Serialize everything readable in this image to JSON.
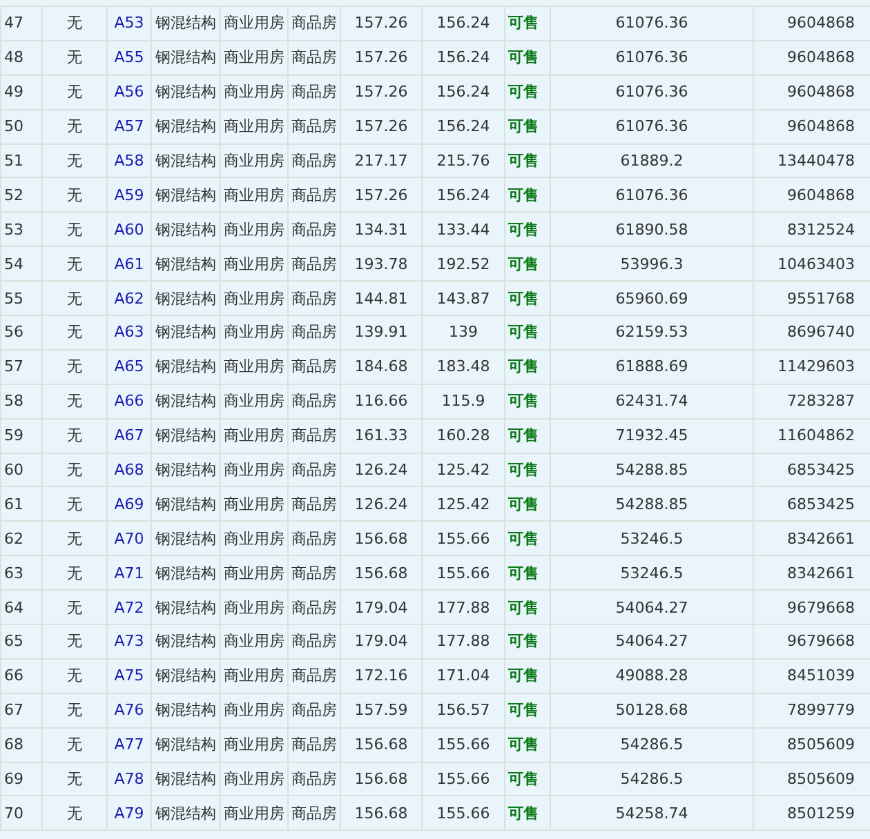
{
  "table": {
    "rows": [
      {
        "cells": [
          "47",
          "无",
          "A53",
          "钢混结构",
          "商业用房",
          "商品房",
          "157.26",
          "156.24",
          "可售",
          "61076.36",
          "9604868"
        ]
      },
      {
        "cells": [
          "48",
          "无",
          "A55",
          "钢混结构",
          "商业用房",
          "商品房",
          "157.26",
          "156.24",
          "可售",
          "61076.36",
          "9604868"
        ]
      },
      {
        "cells": [
          "49",
          "无",
          "A56",
          "钢混结构",
          "商业用房",
          "商品房",
          "157.26",
          "156.24",
          "可售",
          "61076.36",
          "9604868"
        ]
      },
      {
        "cells": [
          "50",
          "无",
          "A57",
          "钢混结构",
          "商业用房",
          "商品房",
          "157.26",
          "156.24",
          "可售",
          "61076.36",
          "9604868"
        ]
      },
      {
        "cells": [
          "51",
          "无",
          "A58",
          "钢混结构",
          "商业用房",
          "商品房",
          "217.17",
          "215.76",
          "可售",
          "61889.2",
          "13440478"
        ]
      },
      {
        "cells": [
          "52",
          "无",
          "A59",
          "钢混结构",
          "商业用房",
          "商品房",
          "157.26",
          "156.24",
          "可售",
          "61076.36",
          "9604868"
        ]
      },
      {
        "cells": [
          "53",
          "无",
          "A60",
          "钢混结构",
          "商业用房",
          "商品房",
          "134.31",
          "133.44",
          "可售",
          "61890.58",
          "8312524"
        ]
      },
      {
        "cells": [
          "54",
          "无",
          "A61",
          "钢混结构",
          "商业用房",
          "商品房",
          "193.78",
          "192.52",
          "可售",
          "53996.3",
          "10463403"
        ]
      },
      {
        "cells": [
          "55",
          "无",
          "A62",
          "钢混结构",
          "商业用房",
          "商品房",
          "144.81",
          "143.87",
          "可售",
          "65960.69",
          "9551768"
        ]
      },
      {
        "cells": [
          "56",
          "无",
          "A63",
          "钢混结构",
          "商业用房",
          "商品房",
          "139.91",
          "139",
          "可售",
          "62159.53",
          "8696740"
        ]
      },
      {
        "cells": [
          "57",
          "无",
          "A65",
          "钢混结构",
          "商业用房",
          "商品房",
          "184.68",
          "183.48",
          "可售",
          "61888.69",
          "11429603"
        ]
      },
      {
        "cells": [
          "58",
          "无",
          "A66",
          "钢混结构",
          "商业用房",
          "商品房",
          "116.66",
          "115.9",
          "可售",
          "62431.74",
          "7283287"
        ]
      },
      {
        "cells": [
          "59",
          "无",
          "A67",
          "钢混结构",
          "商业用房",
          "商品房",
          "161.33",
          "160.28",
          "可售",
          "71932.45",
          "11604862"
        ]
      },
      {
        "cells": [
          "60",
          "无",
          "A68",
          "钢混结构",
          "商业用房",
          "商品房",
          "126.24",
          "125.42",
          "可售",
          "54288.85",
          "6853425"
        ]
      },
      {
        "cells": [
          "61",
          "无",
          "A69",
          "钢混结构",
          "商业用房",
          "商品房",
          "126.24",
          "125.42",
          "可售",
          "54288.85",
          "6853425"
        ]
      },
      {
        "cells": [
          "62",
          "无",
          "A70",
          "钢混结构",
          "商业用房",
          "商品房",
          "156.68",
          "155.66",
          "可售",
          "53246.5",
          "8342661"
        ]
      },
      {
        "cells": [
          "63",
          "无",
          "A71",
          "钢混结构",
          "商业用房",
          "商品房",
          "156.68",
          "155.66",
          "可售",
          "53246.5",
          "8342661"
        ]
      },
      {
        "cells": [
          "64",
          "无",
          "A72",
          "钢混结构",
          "商业用房",
          "商品房",
          "179.04",
          "177.88",
          "可售",
          "54064.27",
          "9679668"
        ]
      },
      {
        "cells": [
          "65",
          "无",
          "A73",
          "钢混结构",
          "商业用房",
          "商品房",
          "179.04",
          "177.88",
          "可售",
          "54064.27",
          "9679668"
        ]
      },
      {
        "cells": [
          "66",
          "无",
          "A75",
          "钢混结构",
          "商业用房",
          "商品房",
          "172.16",
          "171.04",
          "可售",
          "49088.28",
          "8451039"
        ]
      },
      {
        "cells": [
          "67",
          "无",
          "A76",
          "钢混结构",
          "商业用房",
          "商品房",
          "157.59",
          "156.57",
          "可售",
          "50128.68",
          "7899779"
        ]
      },
      {
        "cells": [
          "68",
          "无",
          "A77",
          "钢混结构",
          "商业用房",
          "商品房",
          "156.68",
          "155.66",
          "可售",
          "54286.5",
          "8505609"
        ]
      },
      {
        "cells": [
          "69",
          "无",
          "A78",
          "钢混结构",
          "商业用房",
          "商品房",
          "156.68",
          "155.66",
          "可售",
          "54286.5",
          "8505609"
        ]
      },
      {
        "cells": [
          "70",
          "无",
          "A79",
          "钢混结构",
          "商业用房",
          "商品房",
          "156.68",
          "155.66",
          "可售",
          "54258.74",
          "8501259"
        ]
      }
    ]
  }
}
